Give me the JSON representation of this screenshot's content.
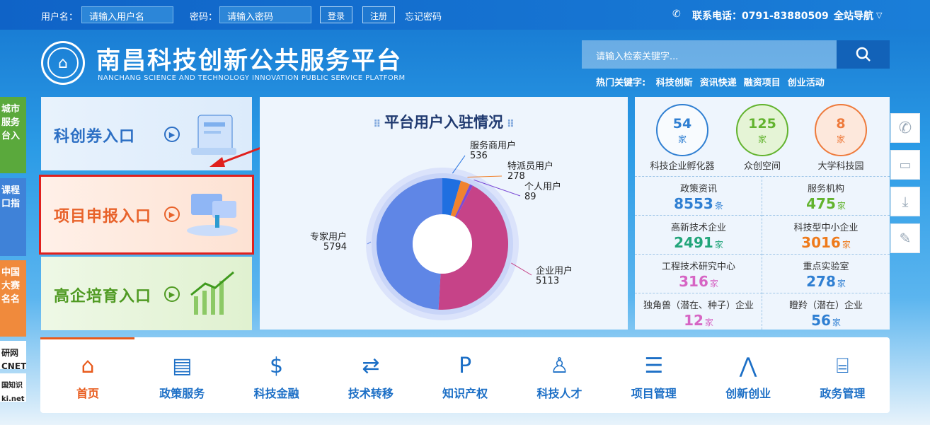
{
  "topbar": {
    "username_label": "用户名：",
    "username_placeholder": "请输入用户名",
    "password_label": "密码：",
    "password_placeholder": "请输入密码",
    "login_button": "登录",
    "register_button": "注册",
    "forgot_link": "忘记密码",
    "phone_label": "联系电话：0791-83880509",
    "site_nav": "全站导航"
  },
  "header": {
    "title": "南昌科技创新公共服务平台",
    "subtitle": "NANCHANG SCIENCE AND TECHNOLOGY INNOVATION PUBLIC SERVICE PLATFORM",
    "search_placeholder": "请输入检索关键字...",
    "hot_label": "热门关键字:",
    "hot_words": [
      "科技创新",
      "资讯快递",
      "融资项目",
      "创业活动"
    ]
  },
  "left_tabs": [
    "城市服务台入",
    "课程口指",
    "中国大赛名名",
    "研网CNET",
    "国知识ki.net"
  ],
  "entries": [
    {
      "label": "科创券入口"
    },
    {
      "label": "项目申报入口"
    },
    {
      "label": "高企培育入口"
    }
  ],
  "chart_data": {
    "type": "pie",
    "title": "平台用户入驻情况",
    "slices": [
      {
        "name": "服务商用户",
        "value": 536,
        "color": "#1f6fe0"
      },
      {
        "name": "特派员用户",
        "value": 278,
        "color": "#f0832f"
      },
      {
        "name": "个人用户",
        "value": 89,
        "color": "#7b4bd6"
      },
      {
        "name": "企业用户",
        "value": 5113,
        "color": "#c64388"
      },
      {
        "name": "专家用户",
        "value": 5794,
        "color": "#5f86e6"
      }
    ]
  },
  "stats": {
    "circles": [
      {
        "value": "54",
        "unit": "家",
        "label": "科技企业孵化器",
        "color": "#2f7fd2"
      },
      {
        "value": "125",
        "unit": "家",
        "label": "众创空间",
        "color": "#62b32e"
      },
      {
        "value": "8",
        "unit": "家",
        "label": "大学科技园",
        "color": "#ee7a3b"
      }
    ],
    "grid": [
      {
        "label": "政策资讯",
        "value": "8553",
        "unit": "条",
        "color": "#2f7fd2"
      },
      {
        "label": "服务机构",
        "value": "475",
        "unit": "家",
        "color": "#62b32e"
      },
      {
        "label": "高新技术企业",
        "value": "2491",
        "unit": "家",
        "color": "#22a57a"
      },
      {
        "label": "科技型中小企业",
        "value": "3016",
        "unit": "家",
        "color": "#ee7a1b"
      },
      {
        "label": "工程技术研究中心",
        "value": "316",
        "unit": "家",
        "color": "#d665c4"
      },
      {
        "label": "重点实验室",
        "value": "278",
        "unit": "家",
        "color": "#2f7fd2"
      },
      {
        "label": "独角兽（潜在、种子）企业",
        "value": "12",
        "unit": "家",
        "color": "#d665c4"
      },
      {
        "label": "瞪羚（潜在）企业",
        "value": "56",
        "unit": "家",
        "color": "#2f7fd2"
      }
    ]
  },
  "nav": [
    {
      "label": "首页",
      "icon": "home-icon",
      "active": true
    },
    {
      "label": "政策服务",
      "icon": "document-icon"
    },
    {
      "label": "科技金融",
      "icon": "moneybag-icon"
    },
    {
      "label": "技术转移",
      "icon": "transfer-icon"
    },
    {
      "label": "知识产权",
      "icon": "ip-icon"
    },
    {
      "label": "科技人才",
      "icon": "talent-icon"
    },
    {
      "label": "项目管理",
      "icon": "project-icon"
    },
    {
      "label": "创新创业",
      "icon": "innovation-icon"
    },
    {
      "label": "政务管理",
      "icon": "government-icon"
    }
  ],
  "right_tools": [
    "phone-icon",
    "chat-icon",
    "download-icon",
    "edit-icon"
  ]
}
